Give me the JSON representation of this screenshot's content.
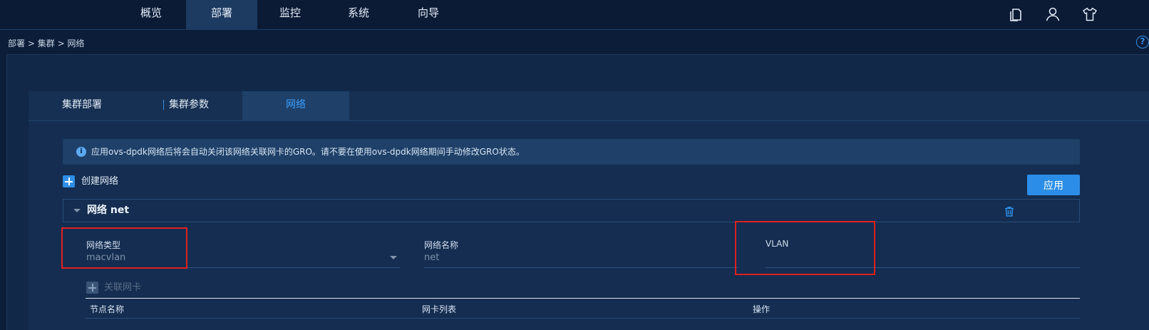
{
  "nav": {
    "items": [
      {
        "label": "概览"
      },
      {
        "label": "部署"
      },
      {
        "label": "监控"
      },
      {
        "label": "系统"
      },
      {
        "label": "向导"
      }
    ],
    "active": "部署",
    "icons": [
      "copy-icon",
      "user-icon",
      "shirt-icon"
    ]
  },
  "breadcrumb": {
    "items": [
      "部署",
      "集群",
      "网络"
    ],
    "separator": ">"
  },
  "help": {
    "label": "?"
  },
  "tabs": {
    "items": [
      {
        "label": "集群部署"
      },
      {
        "label": "集群参数"
      },
      {
        "label": "网络"
      }
    ],
    "active": "网络"
  },
  "notice": {
    "icon": "info-icon",
    "icon_glyph": "i",
    "text": "应用ovs-dpdk网络后将会自动关闭该网络关联网卡的GRO。请不要在使用ovs-dpdk网络期间手动修改GRO状态。"
  },
  "actions": {
    "create_network": "创建网络",
    "apply": "应用"
  },
  "network": {
    "title": "网络 net",
    "fields": {
      "type": {
        "label": "网络类型",
        "value": "macvlan"
      },
      "name": {
        "label": "网络名称",
        "value": "net"
      },
      "vlan": {
        "label": "VLAN",
        "value": ""
      }
    },
    "associate_nic": "关联网卡",
    "table": {
      "columns": [
        "节点名称",
        "网卡列表",
        "操作"
      ]
    }
  },
  "colors": {
    "accent": "#2b8de8",
    "highlight_box": "#e02020",
    "active_tab_text": "#3aa0ff"
  }
}
